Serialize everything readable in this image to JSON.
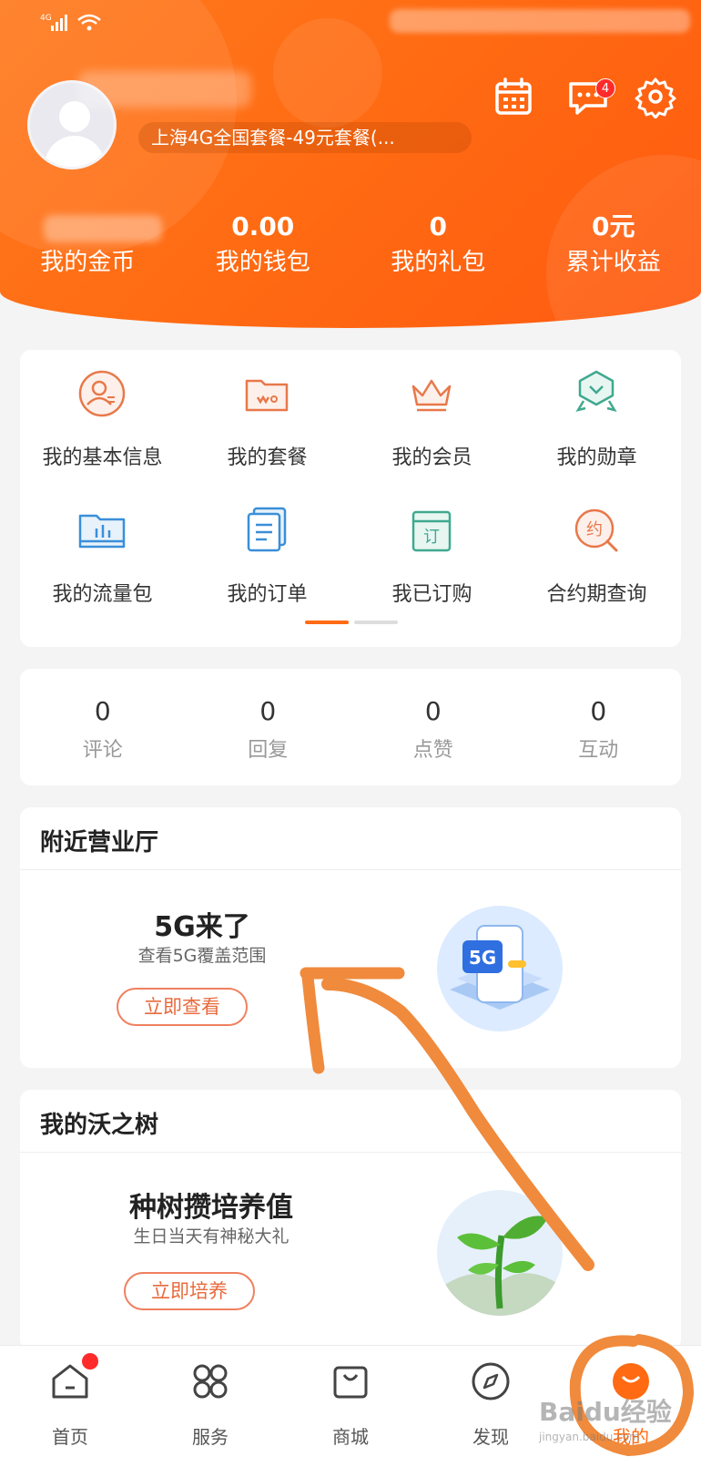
{
  "profile": {
    "plan": "上海4G全国套餐-49元套餐(...",
    "message_badge": "4"
  },
  "stats": [
    {
      "value": "",
      "label": "我的金币"
    },
    {
      "value": "0.00",
      "label": "我的钱包"
    },
    {
      "value": "0",
      "label": "我的礼包"
    },
    {
      "value": "0元",
      "label": "累计收益"
    }
  ],
  "menu": [
    {
      "label": "我的基本信息",
      "icon": "person-card-icon"
    },
    {
      "label": "我的套餐",
      "icon": "package-folder-icon"
    },
    {
      "label": "我的会员",
      "icon": "crown-icon"
    },
    {
      "label": "我的勋章",
      "icon": "medal-icon"
    },
    {
      "label": "我的流量包",
      "icon": "data-folder-icon"
    },
    {
      "label": "我的订单",
      "icon": "order-doc-icon"
    },
    {
      "label": "我已订购",
      "icon": "subscribed-icon"
    },
    {
      "label": "合约期查询",
      "icon": "contract-search-icon"
    }
  ],
  "pager": {
    "active_page": 1,
    "page_count": 2
  },
  "counts": [
    {
      "value": "0",
      "label": "评论"
    },
    {
      "value": "0",
      "label": "回复"
    },
    {
      "value": "0",
      "label": "点赞"
    },
    {
      "value": "0",
      "label": "互动"
    }
  ],
  "nearby": {
    "title": "附近营业厅",
    "promo_title": "5G来了",
    "promo_sub": "查看5G覆盖范围",
    "button": "立即查看",
    "art_label": "5G"
  },
  "tree": {
    "title": "我的沃之树",
    "promo_title": "种树攒培养值",
    "promo_sub": "生日当天有神秘大礼",
    "button": "立即培养"
  },
  "tabs": [
    {
      "label": "首页",
      "icon": "home-icon"
    },
    {
      "label": "服务",
      "icon": "services-icon"
    },
    {
      "label": "商城",
      "icon": "shopping-bag-icon"
    },
    {
      "label": "发现",
      "icon": "compass-icon"
    },
    {
      "label": "我的",
      "icon": "me-icon"
    }
  ],
  "watermark": {
    "text": "Baidu经验",
    "url": "jingyan.baidu.com"
  },
  "colors": {
    "brand_orange": "#ff6a12",
    "accent_red": "#ff2a2a",
    "button_text": "#e86a3c",
    "annotation_orange": "#f08a3c"
  }
}
